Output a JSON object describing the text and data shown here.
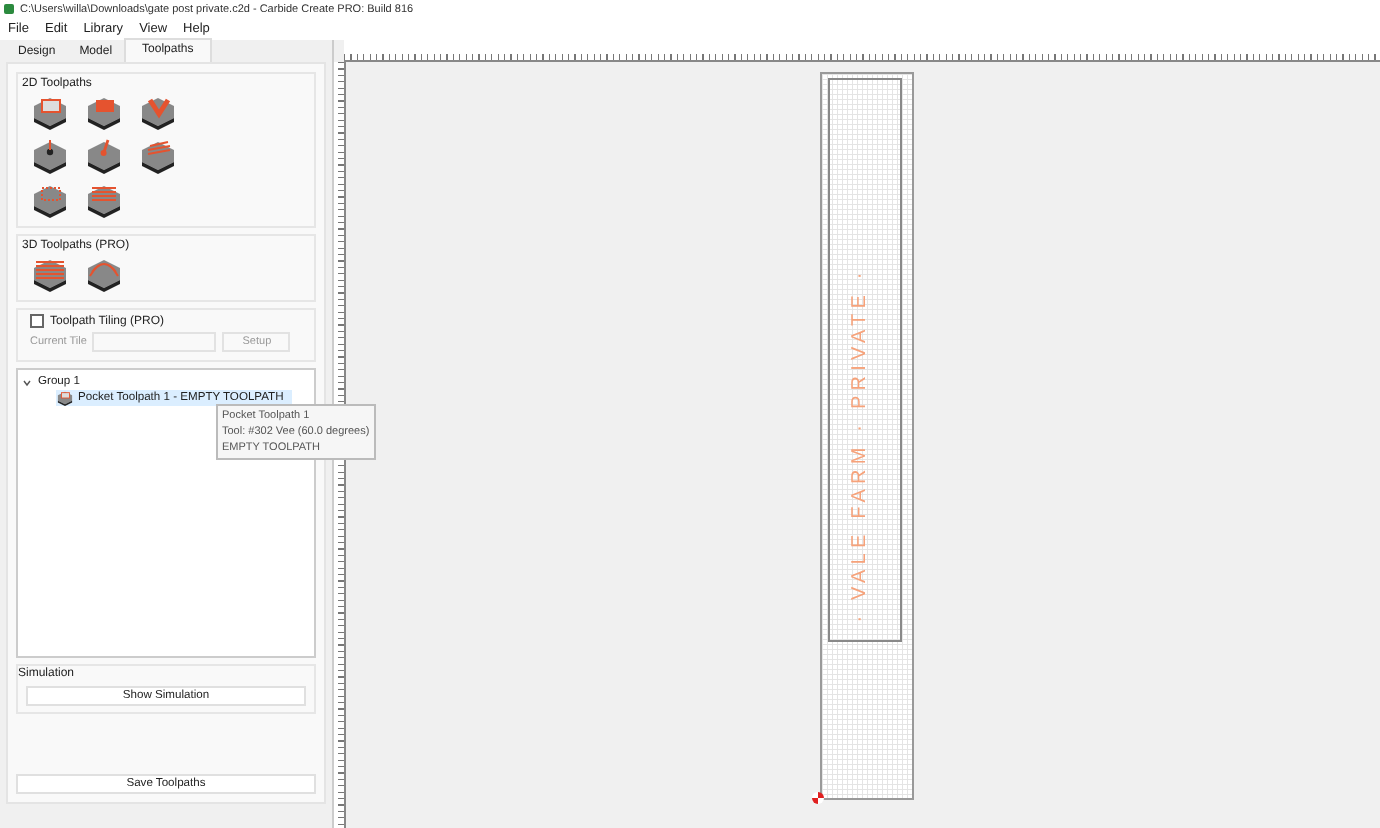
{
  "window": {
    "title": "C:\\Users\\willa\\Downloads\\gate post private.c2d - Carbide Create PRO: Build 816"
  },
  "menu": [
    {
      "label": "File"
    },
    {
      "label": "Edit"
    },
    {
      "label": "Library"
    },
    {
      "label": "View"
    },
    {
      "label": "Help"
    }
  ],
  "tabs": [
    {
      "label": "Design",
      "selected": false
    },
    {
      "label": "Model",
      "selected": false
    },
    {
      "label": "Toolpaths",
      "selected": true
    }
  ],
  "toolpath_groups": [
    {
      "title": "2D Toolpaths",
      "kind": "flat"
    },
    {
      "title": "3D Toolpaths (PRO)",
      "kind": "relief"
    }
  ],
  "tiling": {
    "label": "Toolpath Tiling (PRO)",
    "checked": false,
    "tile_label": "Current Tile",
    "setup": "Setup"
  },
  "tree": [
    {
      "label": "Group 1",
      "expanded": true,
      "children": [
        {
          "label": "Pocket Toolpath 1 - EMPTY TOOLPATH",
          "selected": true
        }
      ]
    }
  ],
  "tooltip": {
    "lines": [
      "Pocket Toolpath 1",
      "Tool: #302 Vee (60.0 degrees)",
      "EMPTY TOOLPATH"
    ]
  },
  "simulation": {
    "title": "Simulation",
    "button": "Show Simulation"
  },
  "save_button": "Save Toolpaths",
  "canvas": {
    "text": "· VALE FARM · PRIVATE ·"
  }
}
